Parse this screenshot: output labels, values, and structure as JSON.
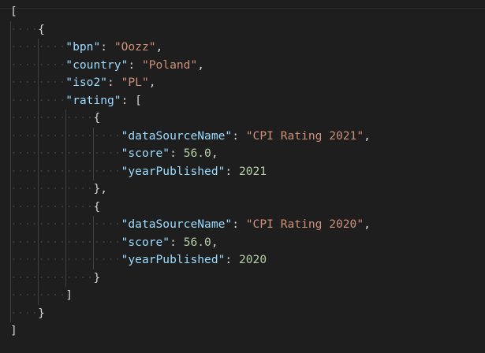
{
  "editor": {
    "language": "json",
    "colors": {
      "background": "#1e1e1e",
      "key": "#9cdcfe",
      "string": "#ce9178",
      "number": "#b5cea8",
      "punctuation": "#d4d4d4",
      "whitespace": "#3b3b3b",
      "guide": "#404040"
    },
    "lines": [
      {
        "indent": 0,
        "tokens": [
          {
            "t": "punc",
            "v": "["
          }
        ]
      },
      {
        "indent": 1,
        "tokens": [
          {
            "t": "punc",
            "v": "{"
          }
        ]
      },
      {
        "indent": 2,
        "tokens": [
          {
            "t": "key",
            "v": "\"bpn\""
          },
          {
            "t": "punc",
            "v": ": "
          },
          {
            "t": "str",
            "v": "\"Oozz\""
          },
          {
            "t": "punc",
            "v": ","
          }
        ]
      },
      {
        "indent": 2,
        "tokens": [
          {
            "t": "key",
            "v": "\"country\""
          },
          {
            "t": "punc",
            "v": ": "
          },
          {
            "t": "str",
            "v": "\"Poland\""
          },
          {
            "t": "punc",
            "v": ","
          }
        ]
      },
      {
        "indent": 2,
        "tokens": [
          {
            "t": "key",
            "v": "\"iso2\""
          },
          {
            "t": "punc",
            "v": ": "
          },
          {
            "t": "str",
            "v": "\"PL\""
          },
          {
            "t": "punc",
            "v": ","
          }
        ]
      },
      {
        "indent": 2,
        "tokens": [
          {
            "t": "key",
            "v": "\"rating\""
          },
          {
            "t": "punc",
            "v": ": ["
          }
        ]
      },
      {
        "indent": 3,
        "tokens": [
          {
            "t": "punc",
            "v": "{"
          }
        ]
      },
      {
        "indent": 4,
        "tokens": [
          {
            "t": "key",
            "v": "\"dataSourceName\""
          },
          {
            "t": "punc",
            "v": ": "
          },
          {
            "t": "str",
            "v": "\"CPI Rating 2021\""
          },
          {
            "t": "punc",
            "v": ","
          }
        ]
      },
      {
        "indent": 4,
        "tokens": [
          {
            "t": "key",
            "v": "\"score\""
          },
          {
            "t": "punc",
            "v": ": "
          },
          {
            "t": "num",
            "v": "56.0"
          },
          {
            "t": "punc",
            "v": ","
          }
        ]
      },
      {
        "indent": 4,
        "tokens": [
          {
            "t": "key",
            "v": "\"yearPublished\""
          },
          {
            "t": "punc",
            "v": ": "
          },
          {
            "t": "num",
            "v": "2021"
          }
        ]
      },
      {
        "indent": 3,
        "tokens": [
          {
            "t": "punc",
            "v": "},"
          }
        ]
      },
      {
        "indent": 3,
        "tokens": [
          {
            "t": "punc",
            "v": "{"
          }
        ]
      },
      {
        "indent": 4,
        "tokens": [
          {
            "t": "key",
            "v": "\"dataSourceName\""
          },
          {
            "t": "punc",
            "v": ": "
          },
          {
            "t": "str",
            "v": "\"CPI Rating 2020\""
          },
          {
            "t": "punc",
            "v": ","
          }
        ]
      },
      {
        "indent": 4,
        "tokens": [
          {
            "t": "key",
            "v": "\"score\""
          },
          {
            "t": "punc",
            "v": ": "
          },
          {
            "t": "num",
            "v": "56.0"
          },
          {
            "t": "punc",
            "v": ","
          }
        ]
      },
      {
        "indent": 4,
        "tokens": [
          {
            "t": "key",
            "v": "\"yearPublished\""
          },
          {
            "t": "punc",
            "v": ": "
          },
          {
            "t": "num",
            "v": "2020"
          }
        ]
      },
      {
        "indent": 3,
        "tokens": [
          {
            "t": "punc",
            "v": "}"
          }
        ]
      },
      {
        "indent": 2,
        "tokens": [
          {
            "t": "punc",
            "v": "]"
          }
        ]
      },
      {
        "indent": 1,
        "tokens": [
          {
            "t": "punc",
            "v": "}"
          }
        ]
      },
      {
        "indent": 0,
        "tokens": [
          {
            "t": "punc",
            "v": "]"
          }
        ]
      }
    ]
  }
}
